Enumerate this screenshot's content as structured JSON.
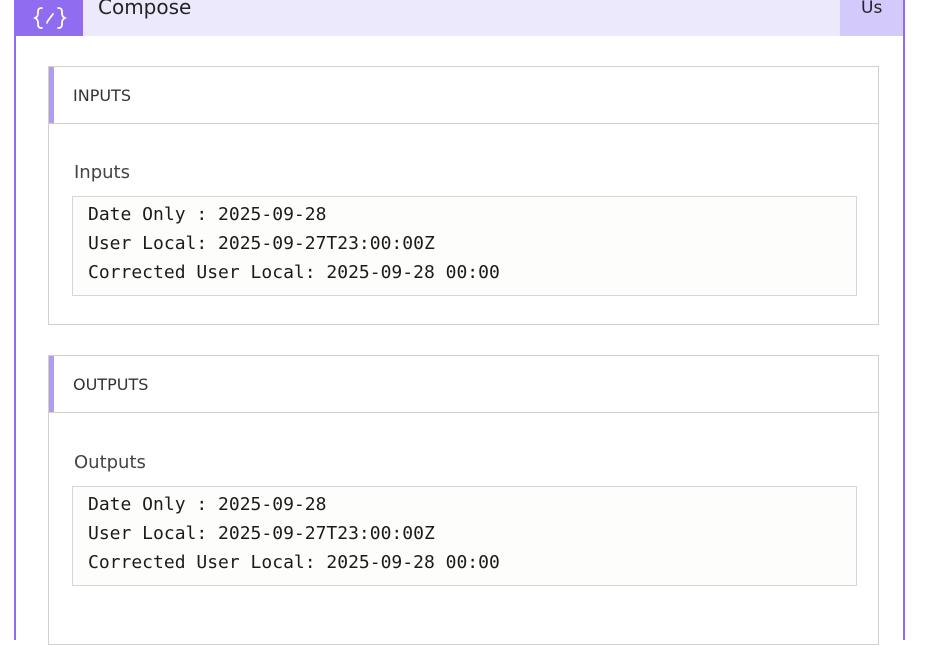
{
  "header": {
    "title": "Compose",
    "right_label": "Us",
    "icon": "curly-braces-icon",
    "accent_color": "#8f6cf0"
  },
  "inputs": {
    "section_title": "INPUTS",
    "field_label": "Inputs",
    "lines": [
      "Date Only : 2025-09-28",
      "User Local: 2025-09-27T23:00:00Z",
      "Corrected User Local: 2025-09-28 00:00"
    ]
  },
  "outputs": {
    "section_title": "OUTPUTS",
    "field_label": "Outputs",
    "lines": [
      "Date Only : 2025-09-28",
      "User Local: 2025-09-27T23:00:00Z",
      "Corrected User Local: 2025-09-28 00:00"
    ]
  }
}
